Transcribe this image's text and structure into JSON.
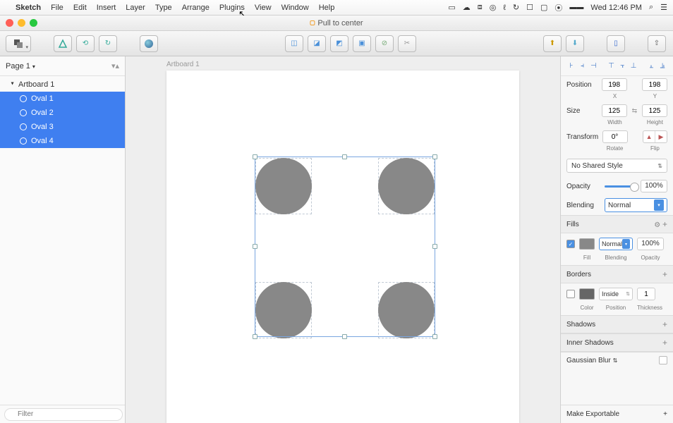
{
  "menubar": {
    "app": "Sketch",
    "items": [
      "File",
      "Edit",
      "Insert",
      "Layer",
      "Type",
      "Arrange",
      "Plugins",
      "View",
      "Window",
      "Help"
    ],
    "clock": "Wed 12:46 PM"
  },
  "titlebar": {
    "title": "Pull to center"
  },
  "sidebar": {
    "page": "Page 1",
    "artboard": "Artboard 1",
    "layers": [
      "Oval 1",
      "Oval 2",
      "Oval 3",
      "Oval 4"
    ],
    "filter_placeholder": "Filter"
  },
  "canvas": {
    "artboard_label": "Artboard 1"
  },
  "inspector": {
    "position_label": "Position",
    "position_x": "198",
    "position_y": "198",
    "x_label": "X",
    "y_label": "Y",
    "size_label": "Size",
    "size_w": "125",
    "size_h": "125",
    "w_label": "Width",
    "h_label": "Height",
    "transform_label": "Transform",
    "rotate": "0°",
    "rotate_label": "Rotate",
    "flip_label": "Flip",
    "shared_style": "No Shared Style",
    "opacity_label": "Opacity",
    "opacity_val": "100%",
    "blending_label": "Blending",
    "blending_val": "Normal",
    "fills_label": "Fills",
    "fill_blend": "Normal",
    "fill_opacity": "100%",
    "fill_sub": "Fill",
    "blend_sub": "Blending",
    "opac_sub": "Opacity",
    "borders_label": "Borders",
    "border_pos": "Inside",
    "border_thick": "1",
    "color_sub": "Color",
    "pos_sub": "Position",
    "thick_sub": "Thickness",
    "shadows_label": "Shadows",
    "inner_shadows_label": "Inner Shadows",
    "gauss_label": "Gaussian Blur",
    "export_label": "Make Exportable"
  }
}
